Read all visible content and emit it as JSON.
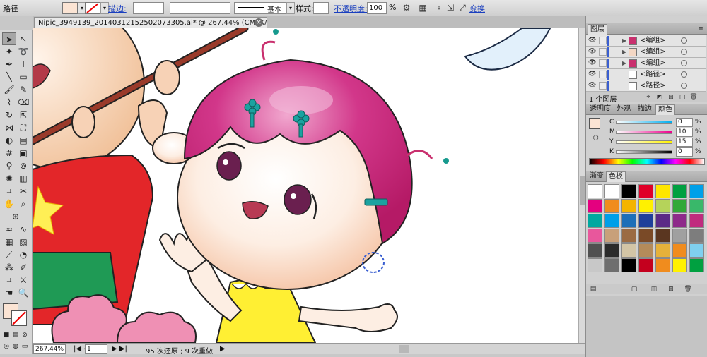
{
  "control_bar": {
    "selection_label": "路径",
    "stroke_label": "描边:",
    "stroke_style": "基本",
    "style_label": "样式:",
    "opacity_label": "不透明度:",
    "opacity_value": "100",
    "opacity_unit": "%",
    "transform_label": "变换"
  },
  "document": {
    "tab_title": "Nipic_3949139_20140312152502073305.ai* @ 267.44% (CMYK/预览)"
  },
  "status": {
    "zoom": "267.44%",
    "artboard": "1",
    "history": "95 次还原 ; 9 次重做"
  },
  "panels": {
    "layers": {
      "title": "图层",
      "rows": [
        {
          "name": "<编组>",
          "thumb": "#c9306e"
        },
        {
          "name": "<编组>",
          "thumb": "#f4d7c4"
        },
        {
          "name": "<编组>",
          "thumb": "#c9306e"
        },
        {
          "name": "<路径>",
          "thumb": "#ffffff"
        },
        {
          "name": "<路径>",
          "thumb": "#ffffff"
        }
      ],
      "footer_count": "1 个图层"
    },
    "color": {
      "tabs": [
        "透明度",
        "外观",
        "描边",
        "颜色"
      ],
      "channels": [
        {
          "label": "C",
          "value": "0"
        },
        {
          "label": "M",
          "value": "10"
        },
        {
          "label": "Y",
          "value": "15"
        },
        {
          "label": "K",
          "value": "0"
        }
      ],
      "unit": "%"
    },
    "swatches": {
      "tabs": [
        "渐变",
        "色板"
      ],
      "colors": [
        "#ffffff",
        "#ffffff",
        "#000000",
        "#e00028",
        "#ffe600",
        "#00a040",
        "#00a0e9",
        "#e4007f",
        "#f08c1e",
        "#f4b400",
        "#fff100",
        "#b5d35a",
        "#32a838",
        "#39b86a",
        "#00a8a0",
        "#009fe8",
        "#1d6fb8",
        "#1f3f9a",
        "#5b2a86",
        "#8e2a8a",
        "#c02b7e",
        "#e8579c",
        "#c8a07a",
        "#9b6b43",
        "#7a4a27",
        "#5a3620",
        "#a0a0a0",
        "#7d7d7d",
        "#505050",
        "#2b2b2b",
        "#d3c5a6",
        "#b48b5a",
        "#e5b13a",
        "#f08c1e",
        "#7fd0ef",
        "#c8c8c8",
        "#6f6f6f",
        "#000000",
        "#c4001e",
        "#f08c1e",
        "#fff100",
        "#00a040",
        "#00a0e9",
        "#f3d9e6",
        "#2ea8a8",
        "#70c1e8",
        "#3aa0d0",
        "#86cbe0",
        "#a98bc4",
        "#d8b4d8",
        "#b5855a",
        "#8b5e3c"
      ]
    }
  },
  "colors": {
    "hair": "#cf1f74",
    "skin": "#fdeee3",
    "shirt": "#e32629",
    "dress": "#ffef33",
    "accent_link": "#1a3fbf"
  }
}
